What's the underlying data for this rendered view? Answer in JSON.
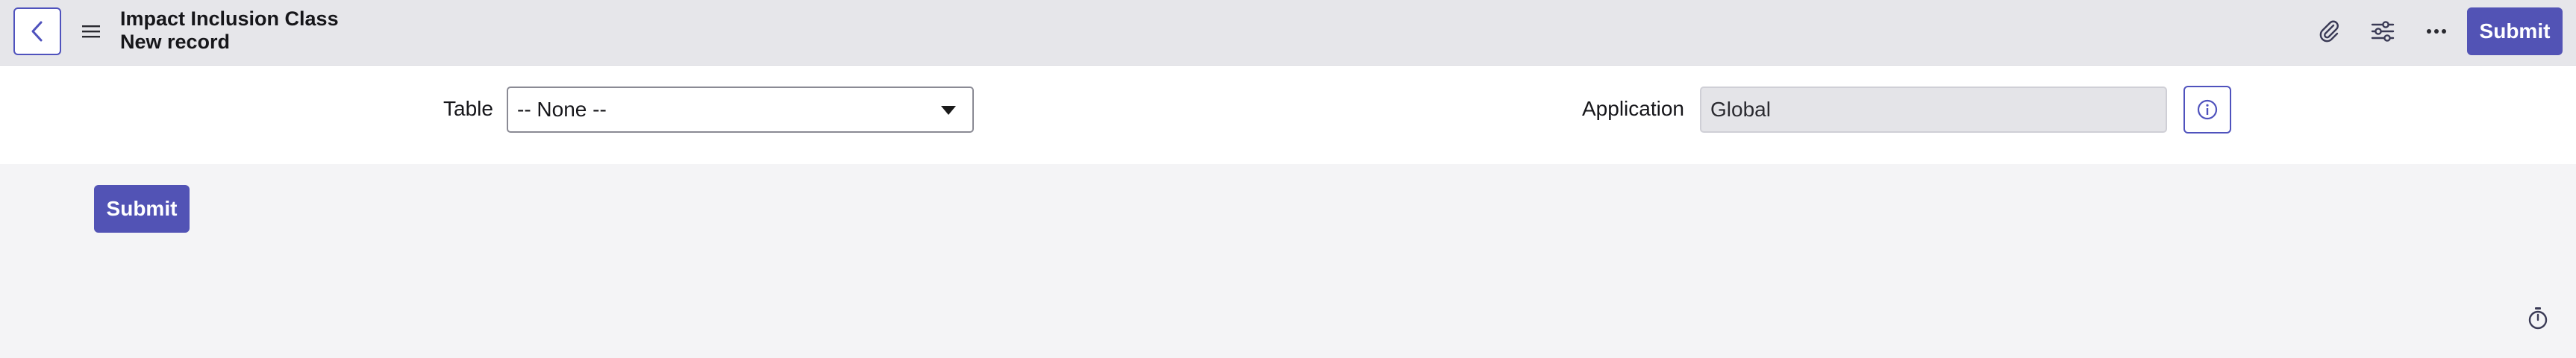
{
  "header": {
    "title": "Impact Inclusion Class",
    "subtitle": "New record",
    "submit_label": "Submit",
    "icons": [
      "back-icon",
      "hamburger-menu-icon",
      "paperclip-icon",
      "sliders-icon",
      "more-horizontal-icon"
    ]
  },
  "form": {
    "table": {
      "label": "Table",
      "value": "-- None --"
    },
    "application": {
      "label": "Application",
      "value": "Global"
    }
  },
  "footer": {
    "submit_label": "Submit",
    "icons": [
      "timer-icon"
    ]
  },
  "colors": {
    "accent": "#5253b5",
    "header_bg": "#e6e6ea",
    "panel_bg": "#ffffff",
    "page_bg": "#f4f4f6",
    "readonly_bg": "#e4e4e8"
  }
}
